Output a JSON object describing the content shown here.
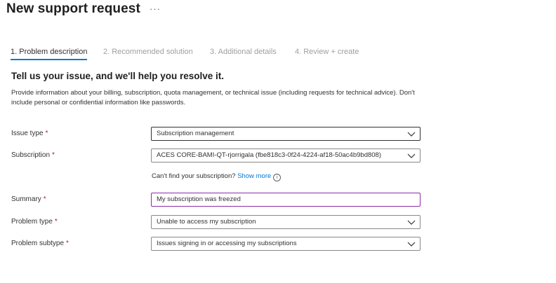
{
  "header": {
    "title": "New support request",
    "more_label": "···"
  },
  "tabs": [
    {
      "label": "1. Problem description",
      "active": true
    },
    {
      "label": "2. Recommended solution",
      "active": false
    },
    {
      "label": "3. Additional details",
      "active": false
    },
    {
      "label": "4. Review + create",
      "active": false
    }
  ],
  "intro": {
    "heading": "Tell us your issue, and we'll help you resolve it.",
    "description": "Provide information about your billing, subscription, quota management, or technical issue (including requests for technical advice). Don't include personal or confidential information like passwords."
  },
  "form": {
    "required_marker": "*",
    "issue_type": {
      "label": "Issue type",
      "value": "Subscription management"
    },
    "subscription": {
      "label": "Subscription",
      "value": "ACES CORE-BAMI-QT-rjorrigala (fbe818c3-0f24-4224-af18-50ac4b9bd808)"
    },
    "subscription_hint": {
      "text": "Can't find your subscription?",
      "link": "Show more",
      "info_icon": "i"
    },
    "summary": {
      "label": "Summary",
      "value": "My subscription was freezed"
    },
    "problem_type": {
      "label": "Problem type",
      "value": "Unable to access my subscription"
    },
    "problem_subtype": {
      "label": "Problem subtype",
      "value": "Issues signing in or accessing my subscriptions"
    }
  },
  "colors": {
    "accent": "#0078d4",
    "required": "#a4262c",
    "summary_border": "#8a2da5"
  }
}
